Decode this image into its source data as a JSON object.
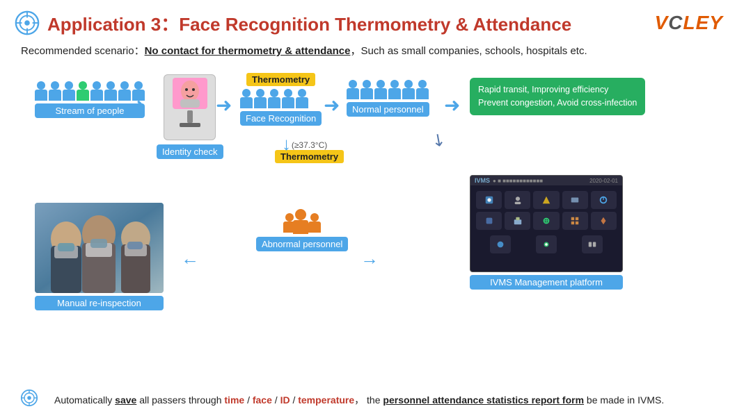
{
  "header": {
    "icon_label": "target-icon",
    "title_prefix": "Application 3：",
    "title_main": "Face Recognition Thermometry & ",
    "title_highlight": "Attendance",
    "logo": "VCLEY"
  },
  "scenario": {
    "label": "Recommended scenario：",
    "highlight": "No contact for thermometry & attendance",
    "rest": "，Such as small companies, schools, hospitals etc."
  },
  "flow": {
    "stream_label": "Stream of people",
    "identity_label": "Identity check",
    "face_label": "Face Recognition",
    "normal_label": "Normal personnel",
    "thermometry_badge": "Thermometry",
    "green_box_line1": "Rapid transit, Improving efficiency",
    "green_box_line2": "Prevent congestion, Avoid cross-infection",
    "temp_label": "(≥37.3°C)",
    "thermometry_badge2": "Thermometry",
    "abnormal_label": "Abnormal personnel",
    "manual_label": "Manual re-inspection",
    "ivms_label": "IVMS Management platform",
    "ivms_title": "IVMS"
  },
  "bottom": {
    "icon_label": "target-small-icon",
    "text1": "Automatically ",
    "save_bold": "save",
    "text2": " all passers through ",
    "time_red": "time",
    "slash1": " / ",
    "face_red": "face",
    "slash2": " / ",
    "id_red": "ID",
    "slash3": " / ",
    "temp_red": "temperature",
    "comma": "，  the ",
    "report_bold": "personnel attendance statistics report form",
    "text3": " be made in IVMS."
  }
}
